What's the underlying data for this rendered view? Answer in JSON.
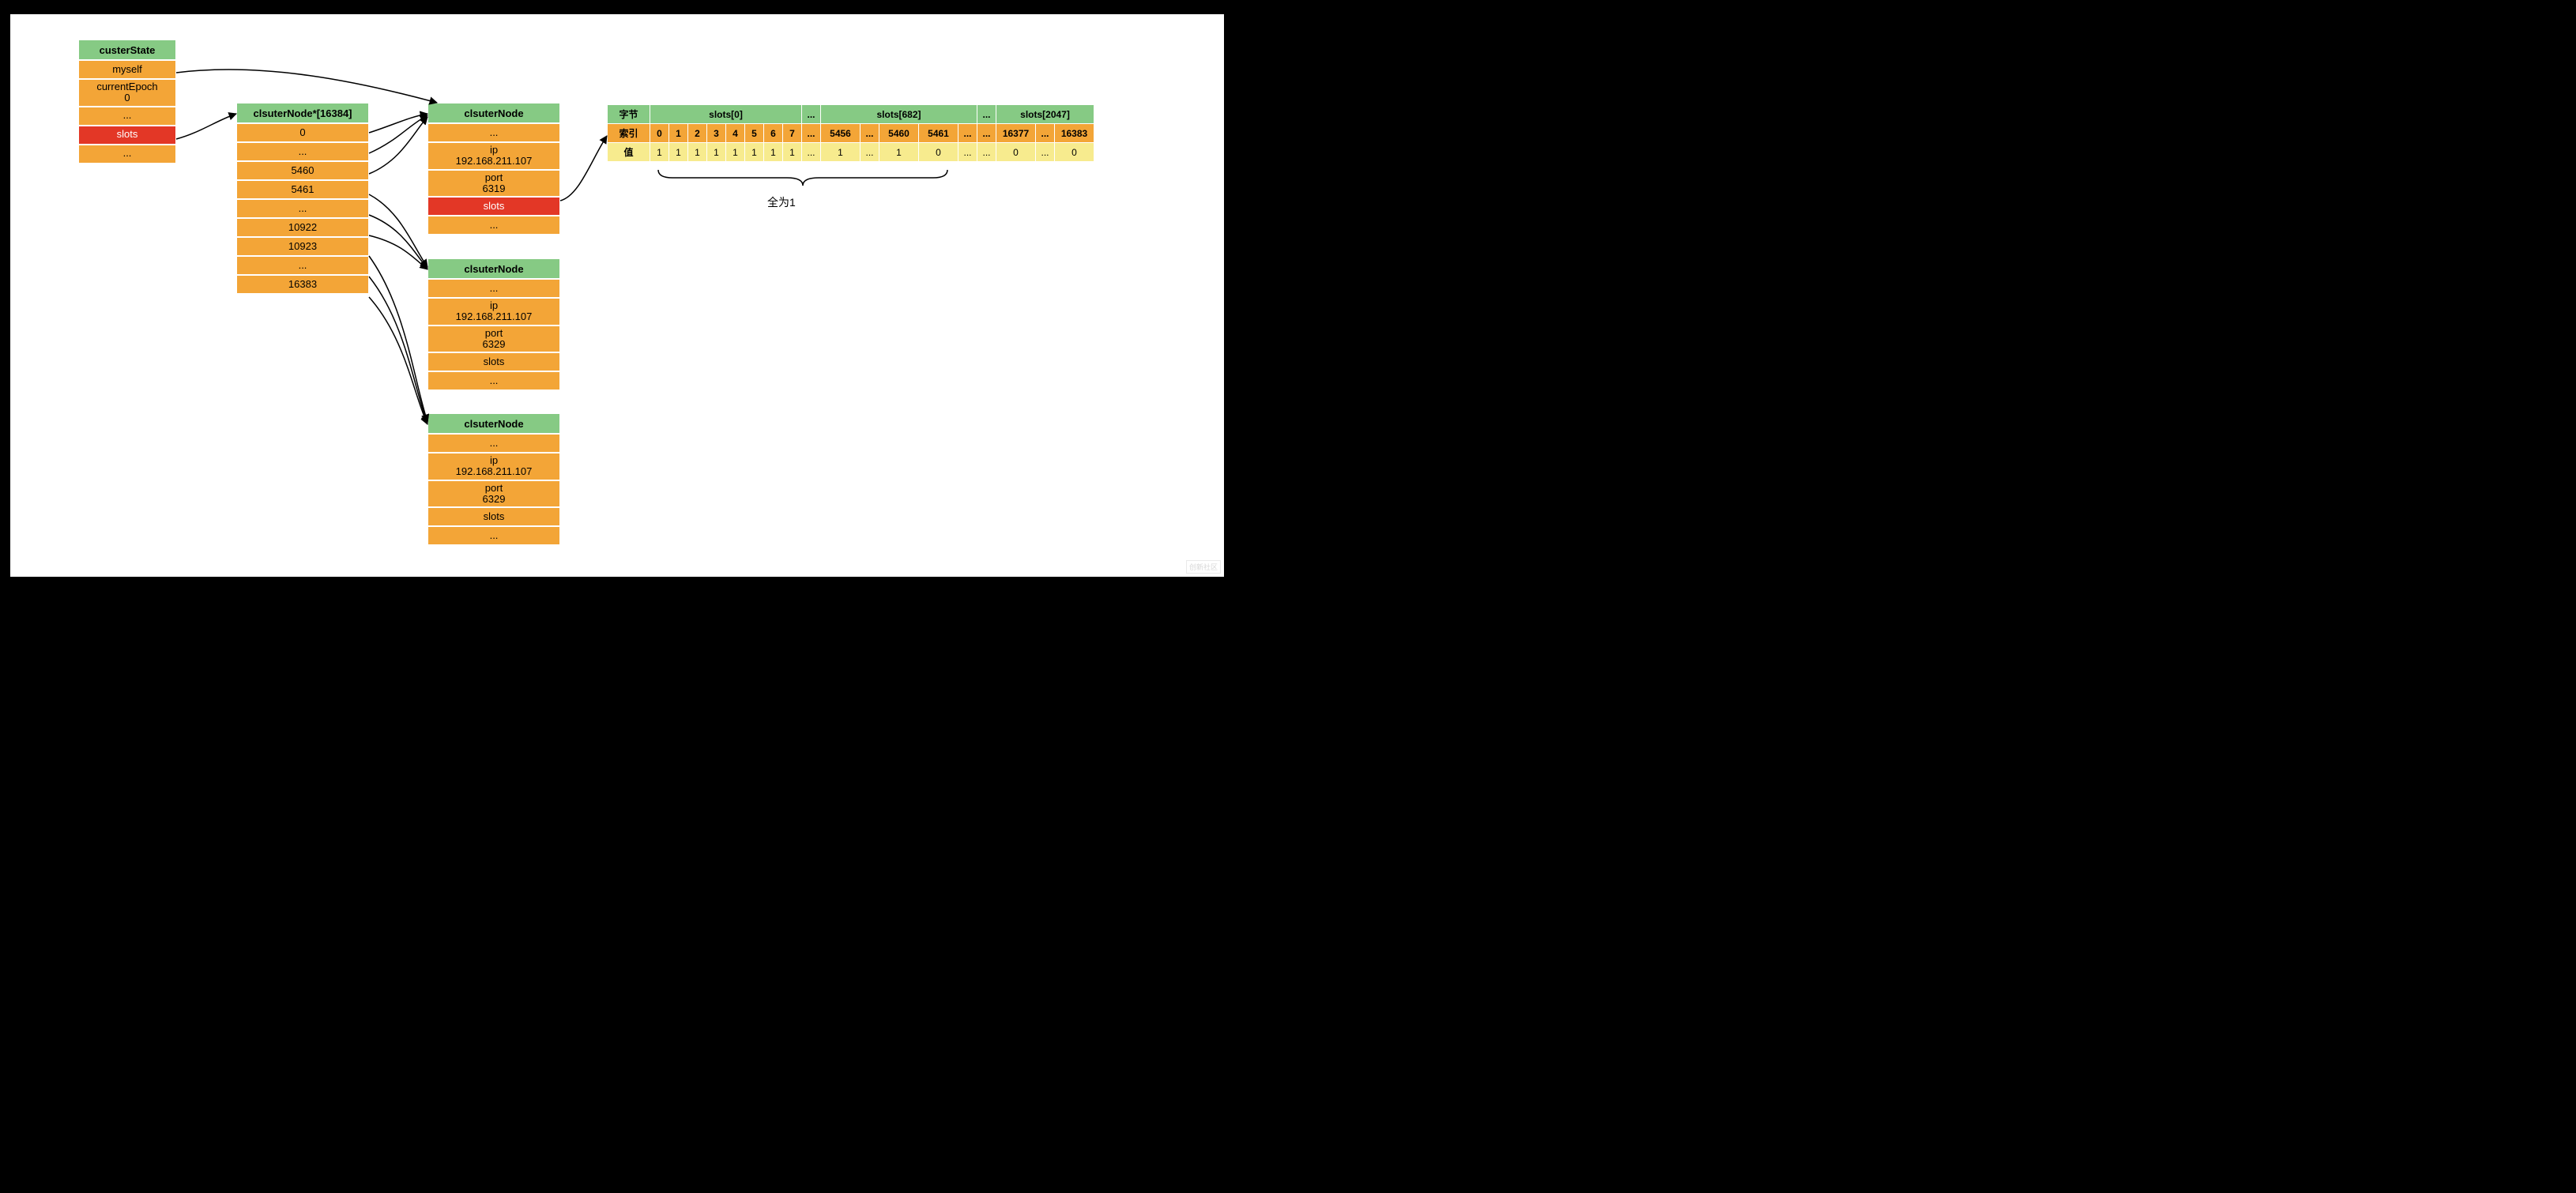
{
  "clusterState": {
    "title": "custerState",
    "rows": [
      "myself",
      "currentEpoch\n0",
      "...",
      "slots",
      "..."
    ],
    "redIndex": 3
  },
  "nodeArray": {
    "title": "clsuterNode*[16384]",
    "rows": [
      "0",
      "...",
      "5460",
      "5461",
      "...",
      "10922",
      "10923",
      "...",
      "16383"
    ]
  },
  "node1": {
    "title": "clsuterNode",
    "rows": [
      "...",
      "ip\n192.168.211.107",
      "port\n6319",
      "slots",
      "..."
    ],
    "redIndex": 3
  },
  "node2": {
    "title": "clsuterNode",
    "rows": [
      "...",
      "ip\n192.168.211.107",
      "port\n6329",
      "slots",
      "..."
    ]
  },
  "node3": {
    "title": "clsuterNode",
    "rows": [
      "...",
      "ip\n192.168.211.107",
      "port\n6329",
      "slots",
      "..."
    ]
  },
  "slotTable": {
    "rowLabels": [
      "字节",
      "索引",
      "值"
    ],
    "groups": [
      {
        "header": "slots[0]",
        "cols": [
          {
            "idx": "0",
            "val": "1"
          },
          {
            "idx": "1",
            "val": "1"
          },
          {
            "idx": "2",
            "val": "1"
          },
          {
            "idx": "3",
            "val": "1"
          },
          {
            "idx": "4",
            "val": "1"
          },
          {
            "idx": "5",
            "val": "1"
          },
          {
            "idx": "6",
            "val": "1"
          },
          {
            "idx": "7",
            "val": "1"
          }
        ]
      },
      {
        "header": "...",
        "cols": [
          {
            "idx": "...",
            "val": "..."
          }
        ]
      },
      {
        "header": "slots[682]",
        "cols": [
          {
            "idx": "5456",
            "val": "1"
          },
          {
            "idx": "...",
            "val": "..."
          },
          {
            "idx": "5460",
            "val": "1"
          },
          {
            "idx": "5461",
            "val": "0"
          },
          {
            "idx": "...",
            "val": "..."
          }
        ]
      },
      {
        "header": "...",
        "cols": [
          {
            "idx": "...",
            "val": "..."
          }
        ]
      },
      {
        "header": "slots[2047]",
        "cols": [
          {
            "idx": "16377",
            "val": "0"
          },
          {
            "idx": "...",
            "val": "..."
          },
          {
            "idx": "16383",
            "val": "0"
          }
        ]
      }
    ],
    "braceLabel": "全为1"
  },
  "watermark": "创新社区"
}
